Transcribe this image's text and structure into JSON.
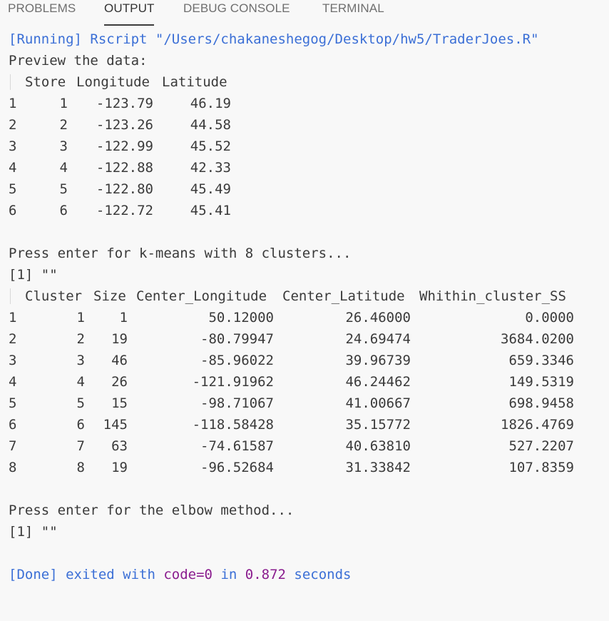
{
  "tabs": [
    {
      "label": "PROBLEMS",
      "active": false
    },
    {
      "label": "OUTPUT",
      "active": true
    },
    {
      "label": "DEBUG CONSOLE",
      "active": false
    },
    {
      "label": "TERMINAL",
      "active": false
    }
  ],
  "colors": {
    "background": "#f8f8f8",
    "text": "#3a3a3a",
    "keyword_blue": "#3b6fd6",
    "value_purple": "#8a1c8e"
  },
  "running": {
    "tag": "[Running]",
    "command": " Rscript \"/Users/chakaneshegog/Desktop/hw5/TraderJoes.R\""
  },
  "preview_label": "Preview the data:",
  "preview_table": {
    "headers": [
      "Store",
      "Longitude",
      "Latitude"
    ],
    "rows": [
      {
        "index": "1",
        "store": "1",
        "longitude": "-123.79",
        "latitude": "46.19"
      },
      {
        "index": "2",
        "store": "2",
        "longitude": "-123.26",
        "latitude": "44.58"
      },
      {
        "index": "3",
        "store": "3",
        "longitude": "-122.99",
        "latitude": "45.52"
      },
      {
        "index": "4",
        "store": "4",
        "longitude": "-122.88",
        "latitude": "42.33"
      },
      {
        "index": "5",
        "store": "5",
        "longitude": "-122.80",
        "latitude": "45.49"
      },
      {
        "index": "6",
        "store": "6",
        "longitude": "-122.72",
        "latitude": "45.41"
      }
    ]
  },
  "kmeans_prompt": "Press enter for k-means with 8 clusters...",
  "kmeans_result": "[1] \"\"",
  "cluster_table": {
    "headers": [
      "Cluster",
      "Size",
      "Center_Longitude",
      "Center_Latitude",
      "Whithin_cluster_SS"
    ],
    "rows": [
      {
        "index": "1",
        "cluster": "1",
        "size": "1",
        "center_longitude": "50.12000",
        "center_latitude": "26.46000",
        "ss": "0.0000"
      },
      {
        "index": "2",
        "cluster": "2",
        "size": "19",
        "center_longitude": "-80.79947",
        "center_latitude": "24.69474",
        "ss": "3684.0200"
      },
      {
        "index": "3",
        "cluster": "3",
        "size": "46",
        "center_longitude": "-85.96022",
        "center_latitude": "39.96739",
        "ss": "659.3346"
      },
      {
        "index": "4",
        "cluster": "4",
        "size": "26",
        "center_longitude": "-121.91962",
        "center_latitude": "46.24462",
        "ss": "149.5319"
      },
      {
        "index": "5",
        "cluster": "5",
        "size": "15",
        "center_longitude": "-98.71067",
        "center_latitude": "41.00667",
        "ss": "698.9458"
      },
      {
        "index": "6",
        "cluster": "6",
        "size": "145",
        "center_longitude": "-118.58428",
        "center_latitude": "35.15772",
        "ss": "1826.4769"
      },
      {
        "index": "7",
        "cluster": "7",
        "size": "63",
        "center_longitude": "-74.61587",
        "center_latitude": "40.63810",
        "ss": "527.2207"
      },
      {
        "index": "8",
        "cluster": "8",
        "size": "19",
        "center_longitude": "-96.52684",
        "center_latitude": "31.33842",
        "ss": "107.8359"
      }
    ]
  },
  "elbow_prompt": "Press enter for the elbow method...",
  "elbow_result": "[1] \"\"",
  "done": {
    "tag": "[Done]",
    "text1": " exited with ",
    "code": "code=0",
    "text2": " in ",
    "time": "0.872",
    "text3": " seconds"
  }
}
